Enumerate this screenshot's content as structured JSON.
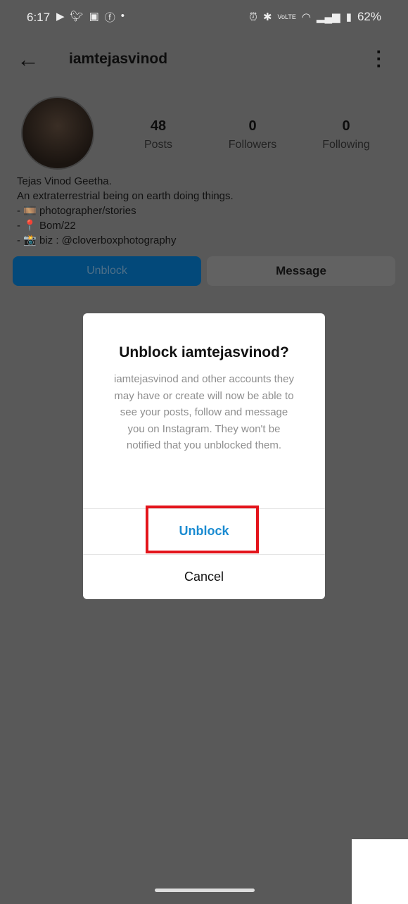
{
  "status_bar": {
    "time": "6:17",
    "left_icons": [
      "youtube-icon",
      "twitter-icon",
      "gallery-icon",
      "facebook-icon",
      "dot-icon"
    ],
    "right_icons": [
      "alarm-icon",
      "bluetooth-icon",
      "volte-icon",
      "wifi-icon",
      "signal-icon",
      "battery-icon"
    ],
    "battery": "62%"
  },
  "header": {
    "username": "iamtejasvinod"
  },
  "profile": {
    "stats": [
      {
        "value": "48",
        "label": "Posts"
      },
      {
        "value": "0",
        "label": "Followers"
      },
      {
        "value": "0",
        "label": "Following"
      }
    ],
    "bio": [
      "Tejas Vinod Geetha.",
      "An extraterrestrial being on earth doing things.",
      "- 🎞️ photographer/stories",
      "- 📍 Bom/22",
      "- 📸 biz : @cloverboxphotography"
    ],
    "unblock_label": "Unblock",
    "message_label": "Message"
  },
  "dialog": {
    "title": "Unblock iamtejasvinod?",
    "body": "iamtejasvinod and other accounts they may have or create will now be able to see your posts, follow and message you on Instagram. They won't be notified that you unblocked them.",
    "confirm_label": "Unblock",
    "cancel_label": "Cancel"
  },
  "colors": {
    "accent": "#1a8bd1",
    "highlight": "#e3141b"
  }
}
